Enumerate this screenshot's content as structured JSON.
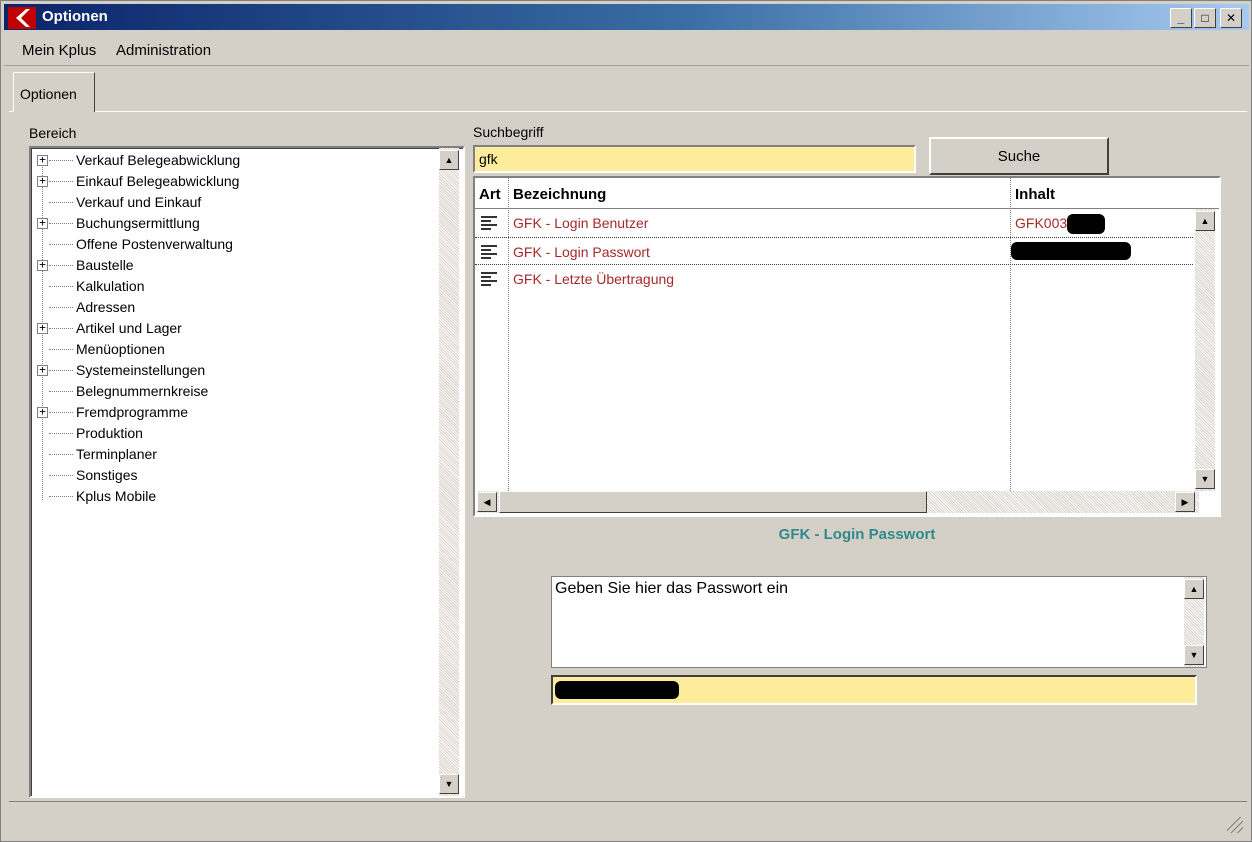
{
  "window": {
    "title": "Optionen"
  },
  "menu": {
    "items": [
      "Mein Kplus",
      "Administration"
    ]
  },
  "tabs": [
    {
      "label": "Optionen"
    }
  ],
  "left": {
    "label": "Bereich",
    "tree": [
      {
        "label": "Verkauf Belegeabwicklung",
        "expandable": true
      },
      {
        "label": "Einkauf Belegeabwicklung",
        "expandable": true
      },
      {
        "label": "Verkauf und Einkauf",
        "expandable": false
      },
      {
        "label": "Buchungsermittlung",
        "expandable": true
      },
      {
        "label": "Offene Postenverwaltung",
        "expandable": false
      },
      {
        "label": "Baustelle",
        "expandable": true
      },
      {
        "label": "Kalkulation",
        "expandable": false
      },
      {
        "label": "Adressen",
        "expandable": false
      },
      {
        "label": "Artikel und Lager",
        "expandable": true
      },
      {
        "label": "Menüoptionen",
        "expandable": false
      },
      {
        "label": "Systemeinstellungen",
        "expandable": true
      },
      {
        "label": "Belegnummernkreise",
        "expandable": false
      },
      {
        "label": "Fremdprogramme",
        "expandable": true
      },
      {
        "label": "Produktion",
        "expandable": false
      },
      {
        "label": "Terminplaner",
        "expandable": false
      },
      {
        "label": "Sonstiges",
        "expandable": false
      },
      {
        "label": "Kplus Mobile",
        "expandable": false
      }
    ]
  },
  "search": {
    "label": "Suchbegriff",
    "value": "gfk",
    "button_label": "Suche"
  },
  "grid": {
    "columns": [
      "Art",
      "Bezeichnung",
      "Inhalt"
    ],
    "rows": [
      {
        "name": "GFK - Login Benutzer",
        "content": "GFK003",
        "selected": false
      },
      {
        "name": "GFK - Login Passwort",
        "content": "",
        "selected": true
      },
      {
        "name": "GFK - Letzte Übertragung",
        "content": "",
        "selected": false
      }
    ]
  },
  "detail": {
    "title": "GFK - Login Passwort",
    "description": "Geben Sie hier das Passwort ein",
    "value": ""
  },
  "colors": {
    "title_gradient_start": "#0a246a",
    "input_yellow": "#fcec9c",
    "row_text": "#a52a2a",
    "detail_title": "#2e8b8b"
  }
}
